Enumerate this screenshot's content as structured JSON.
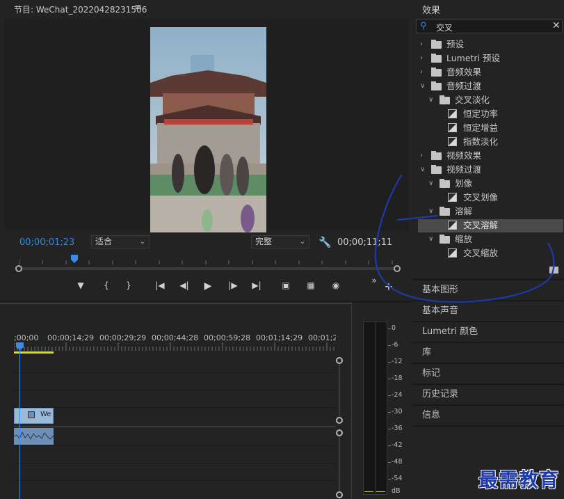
{
  "monitor": {
    "title": "节目: WeChat_20220428231506",
    "menu_icon": "≡",
    "timecode_current": "00;00;01;23",
    "fit": "适合",
    "quality": "完整",
    "timecode_duration": "00;00;11;11",
    "transport": {
      "marker": "marker-icon",
      "in": "mark-in-icon",
      "out": "mark-out-icon",
      "goto_in": "goto-in-icon",
      "step_back": "step-back-icon",
      "play": "play-icon",
      "step_forward": "step-forward-icon",
      "goto_out": "goto-out-icon",
      "lift": "lift-icon",
      "extract": "extract-icon",
      "export_frame": "camera-icon",
      "more": "»",
      "add": "+"
    }
  },
  "effects": {
    "title": "效果",
    "search_value": "交叉",
    "items": [
      {
        "label": "预设",
        "kind": "special-folder",
        "open": false,
        "level": 0
      },
      {
        "label": "Lumetri 预设",
        "kind": "special-folder",
        "open": false,
        "level": 0
      },
      {
        "label": "音频效果",
        "kind": "folder",
        "open": false,
        "level": 0
      },
      {
        "label": "音频过渡",
        "kind": "folder",
        "open": true,
        "level": 0
      },
      {
        "label": "交叉淡化",
        "kind": "folder",
        "open": true,
        "level": 1
      },
      {
        "label": "恒定功率",
        "kind": "effect",
        "level": 2
      },
      {
        "label": "恒定增益",
        "kind": "effect",
        "level": 2
      },
      {
        "label": "指数淡化",
        "kind": "effect",
        "level": 2
      },
      {
        "label": "视频效果",
        "kind": "folder",
        "open": false,
        "level": 0
      },
      {
        "label": "视频过渡",
        "kind": "folder",
        "open": true,
        "level": 0
      },
      {
        "label": "划像",
        "kind": "folder",
        "open": true,
        "level": 1
      },
      {
        "label": "交叉划像",
        "kind": "effect",
        "level": 2
      },
      {
        "label": "溶解",
        "kind": "folder",
        "open": true,
        "level": 1
      },
      {
        "label": "交叉溶解",
        "kind": "effect",
        "level": 2,
        "selected": true
      },
      {
        "label": "缩放",
        "kind": "folder",
        "open": true,
        "level": 1
      },
      {
        "label": "交叉缩放",
        "kind": "effect",
        "level": 2
      }
    ]
  },
  "side_panels": [
    "基本图形",
    "基本声音",
    "Lumetri 颜色",
    "库",
    "标记",
    "历史记录",
    "信息"
  ],
  "timeline": {
    "ruler_labels": [
      ";00;00",
      "00;00;14;29",
      "00;00;29;29",
      "00;00;44;28",
      "00;00;59;28",
      "00;01;14;29",
      "00;01;29"
    ],
    "video_clip_label": "We"
  },
  "meters": {
    "labels": [
      "0",
      "-6",
      "-12",
      "-18",
      "-24",
      "-30",
      "-36",
      "-42",
      "-48",
      "-54",
      "dB"
    ]
  },
  "watermark": "最需教育",
  "colors": {
    "accent": "#2f8ae5",
    "annotation": "#1d3aa8",
    "work_area": "#dadd1b"
  }
}
